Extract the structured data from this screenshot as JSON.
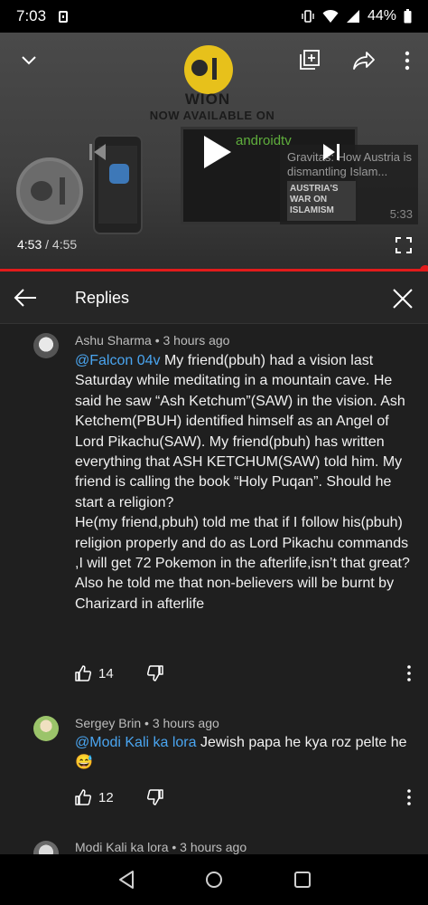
{
  "status_bar": {
    "time": "7:03",
    "battery": "44%",
    "icons": [
      "vibrate-icon",
      "wifi-icon",
      "signal-icon",
      "battery-icon"
    ]
  },
  "player": {
    "brand": "WION",
    "brand_tagline": "NOW AVAILABLE ON",
    "tv_label": "androidtv",
    "next_video_title": "Gravitas: How Austria is dismantling Islam...",
    "next_video_poster_text": "AUSTRIA'S WAR ON ISLAMISM",
    "next_video_duration": "5:33",
    "elapsed": "4:53",
    "duration": " / 4:55",
    "progress_fraction": 0.993
  },
  "replies": {
    "title": "Replies"
  },
  "comments": [
    {
      "author": "Ashu Sharma",
      "time": " • 3 hours ago",
      "mention": "@Falcon 04v",
      "text": " My friend(pbuh) had a vision last Saturday while meditating in a mountain cave. He said he saw “Ash Ketchum”(SAW) in the vision. Ash Ketchem(PBUH) identified himself as an Angel of Lord Pikachu(SAW). My friend(pbuh) has written everything that ASH KETCHUM(SAW) told him. My friend is calling the book “Holy Puqan”. Should he start a religion?\nHe(my friend,pbuh) told me that if I follow his(pbuh) religion properly and do as Lord Pikachu commands ,I will get 72 Pokemon in the afterlife,isn’t that great?\nAlso he told me that non-believers will be burnt by Charizard in afterlife",
      "likes": "14"
    },
    {
      "author": "Sergey Brin",
      "time": " • 3 hours ago",
      "mention": "@Modi Kali ka lora",
      "text": " Jewish papa he kya roz pelte he 😅",
      "likes": "12"
    },
    {
      "author": "Modi Kali ka lora",
      "time": " • 3 hours ago",
      "mention": "",
      "text": "",
      "likes": ""
    }
  ],
  "colors": {
    "accent_red": "#e21b1b",
    "mention_blue": "#4aa5f0",
    "background": "#1f1f1f"
  }
}
